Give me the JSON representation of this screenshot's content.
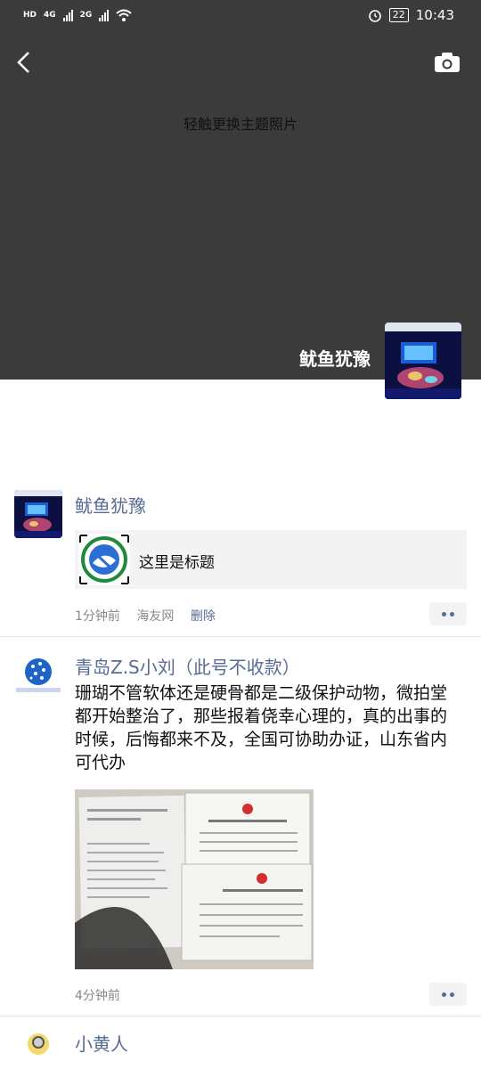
{
  "status_bar": {
    "left_tags": [
      "HD",
      "4G",
      "2G"
    ],
    "battery": "22",
    "time": "10:43"
  },
  "cover": {
    "hint": "轻触更换主题照片",
    "user_name": "鱿鱼犹豫"
  },
  "posts": [
    {
      "author": "鱿鱼犹豫",
      "share_title": "这里是标题",
      "time": "1分钟前",
      "source": "海友网",
      "delete_label": "删除"
    },
    {
      "author": "青岛Z.S小刘（此号不收款）",
      "text": "珊瑚不管软体还是硬骨都是二级保护动物，微拍堂都开始整治了，那些报着侥幸心理的，真的出事的时候，后悔都来不及，全国可协助办证，山东省内可代办",
      "time": "4分钟前"
    },
    {
      "author": "小黄人"
    }
  ],
  "colors": {
    "link": "#576b95",
    "cover": "#3b3b3b"
  },
  "icons": {
    "back": "back-arrow-icon",
    "camera": "camera-icon",
    "more": "more-dots-icon"
  }
}
